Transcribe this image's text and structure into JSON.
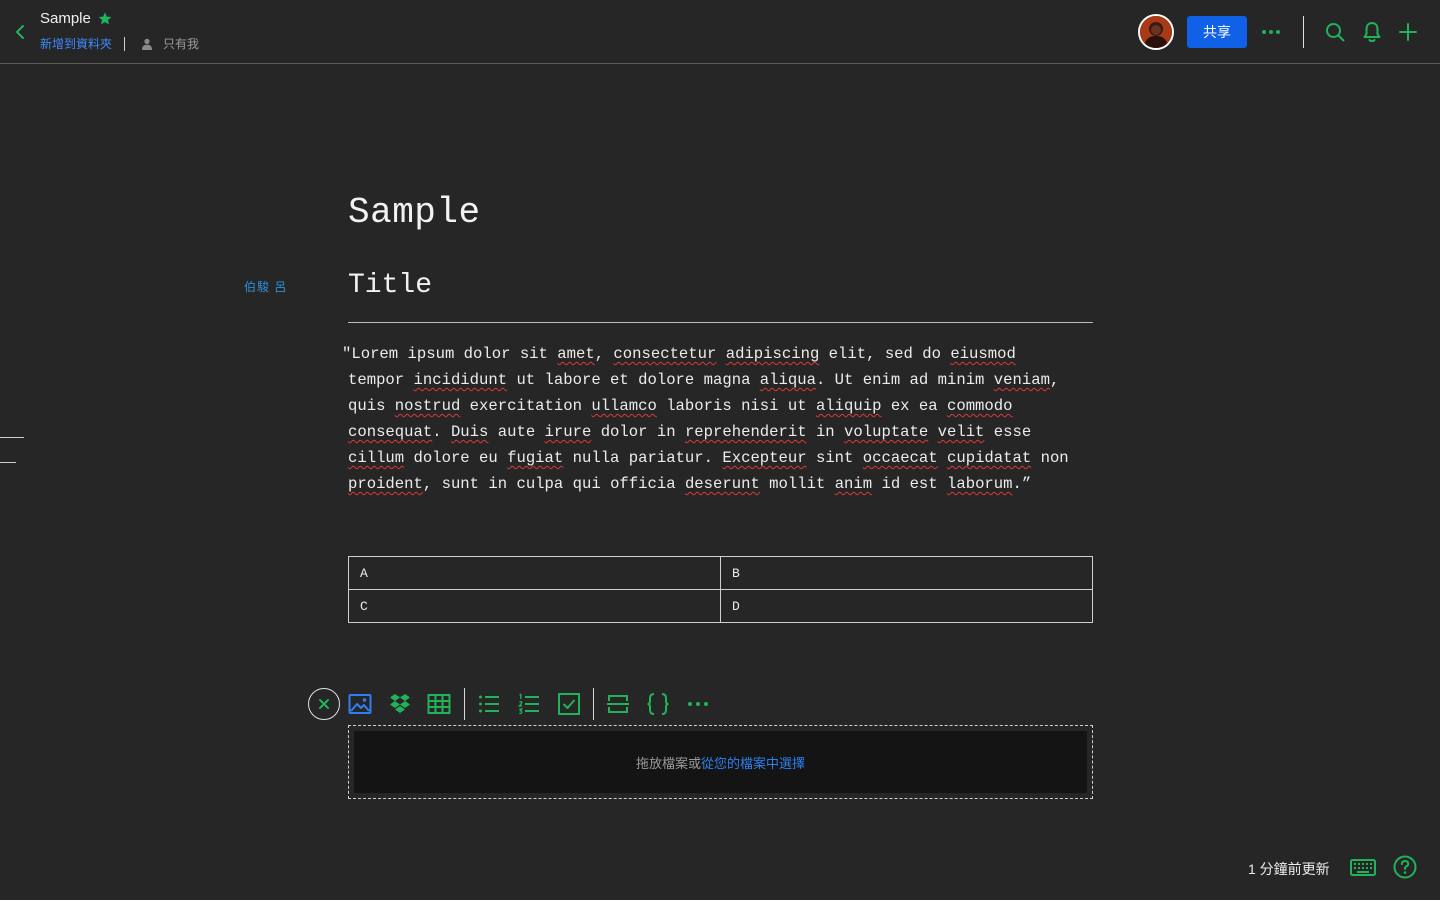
{
  "header": {
    "doc_title": "Sample",
    "add_to_folder": "新增到資料夾",
    "visibility": "只有我",
    "share_label": "共享"
  },
  "document": {
    "heading1": "Sample",
    "author": "伯駿 呂",
    "heading2": "Title",
    "paragraph_lines": [
      "\"Lorem ipsum dolor sit amet, consectetur adipiscing elit, sed do eiusmod",
      "tempor incididunt ut labore et dolore magna aliqua. Ut enim ad minim veniam,",
      "quis nostrud exercitation ullamco laboris nisi ut aliquip ex ea commodo",
      "consequat. Duis aute irure dolor in reprehenderit in voluptate velit esse",
      "cillum dolore eu fugiat nulla pariatur. Excepteur sint occaecat cupidatat non",
      "proident, sunt in culpa qui officia deserunt mollit anim id est laborum.”"
    ],
    "misspelled_words": [
      "amet",
      "consectetur",
      "adipiscing",
      "eiusmod",
      "incididunt",
      "aliqua",
      "veniam",
      "nostrud",
      "ullamco",
      "aliquip",
      "commodo",
      "consequat",
      "Duis",
      "irure",
      "reprehenderit",
      "voluptate",
      "velit",
      "cillum",
      "fugiat",
      "Excepteur",
      "occaecat",
      "cupidatat",
      "proident",
      "deserunt",
      "anim",
      "laborum"
    ],
    "table": [
      [
        "A",
        "B"
      ],
      [
        "C",
        "D"
      ]
    ]
  },
  "toolbar": {
    "icons": [
      "close-icon",
      "image-icon",
      "dropbox-icon",
      "table-icon",
      "bulleted-list-icon",
      "numbered-list-icon",
      "checkbox-icon",
      "divider-icon",
      "code-icon",
      "more-icon"
    ]
  },
  "dropzone": {
    "text": "拖放檔案或",
    "link": "從您的檔案中選擇"
  },
  "footer": {
    "updated": "1 分鐘前更新"
  },
  "colors": {
    "background": "#262626",
    "accent_green": "#1fb35a",
    "primary_blue": "#1061e5",
    "link_blue": "#3d8bff",
    "author_blue": "#2d8fd5",
    "misspell_red": "#d83a3a"
  }
}
